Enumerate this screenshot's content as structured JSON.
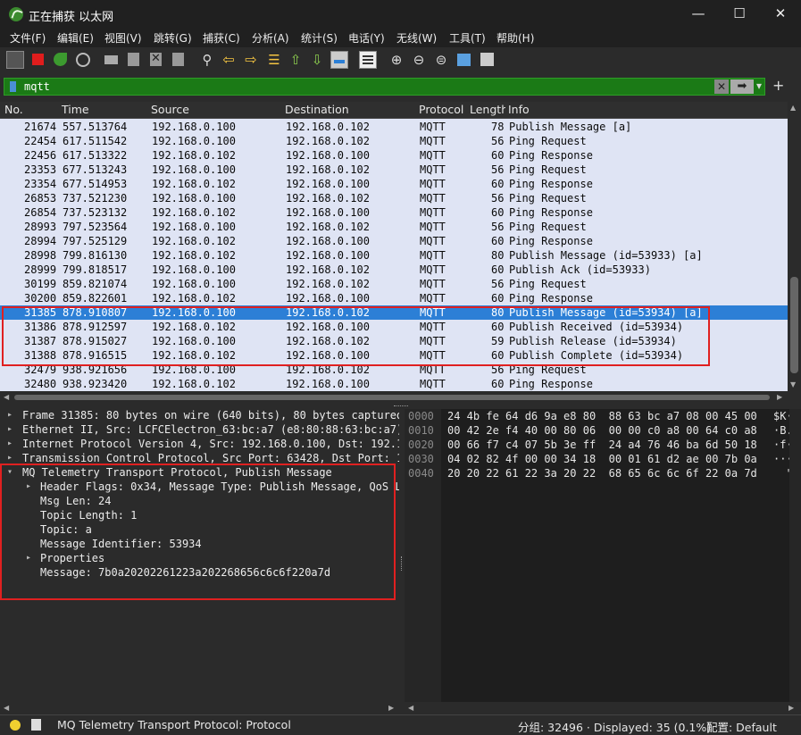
{
  "window": {
    "title": "正在捕获 以太网",
    "minimize": "—",
    "maximize": "☐",
    "close": "✕"
  },
  "menu": [
    "文件(F)",
    "编辑(E)",
    "视图(V)",
    "跳转(G)",
    "捕获(C)",
    "分析(A)",
    "统计(S)",
    "电话(Y)",
    "无线(W)",
    "工具(T)",
    "帮助(H)"
  ],
  "toolbar": [
    "shark-fin-icon",
    "stop-icon",
    "restart-capture-icon",
    "capture-options-icon",
    "open-folder-icon",
    "save-file-icon",
    "close-file-icon",
    "reload-icon",
    "find-packet-icon",
    "go-back-icon",
    "go-forward-icon",
    "go-to-packet-icon",
    "first-packet-icon",
    "last-packet-icon",
    "auto-scroll-icon",
    "colorize-icon",
    "zoom-in-icon",
    "zoom-out-icon",
    "zoom-reset-icon",
    "resize-columns-icon",
    "layout-icon"
  ],
  "filter": {
    "value": "mqtt",
    "clear": "✕",
    "apply": "➡",
    "dropdown": "▾",
    "add": "+"
  },
  "columns": [
    "No.",
    "Time",
    "Source",
    "Destination",
    "Protocol",
    "Length",
    "Info"
  ],
  "packets": [
    [
      "21674",
      "557.513764",
      "192.168.0.100",
      "192.168.0.102",
      "MQTT",
      "78",
      "Publish Message [a]"
    ],
    [
      "22454",
      "617.511542",
      "192.168.0.100",
      "192.168.0.102",
      "MQTT",
      "56",
      "Ping Request"
    ],
    [
      "22456",
      "617.513322",
      "192.168.0.102",
      "192.168.0.100",
      "MQTT",
      "60",
      "Ping Response"
    ],
    [
      "23353",
      "677.513243",
      "192.168.0.100",
      "192.168.0.102",
      "MQTT",
      "56",
      "Ping Request"
    ],
    [
      "23354",
      "677.514953",
      "192.168.0.102",
      "192.168.0.100",
      "MQTT",
      "60",
      "Ping Response"
    ],
    [
      "26853",
      "737.521230",
      "192.168.0.100",
      "192.168.0.102",
      "MQTT",
      "56",
      "Ping Request"
    ],
    [
      "26854",
      "737.523132",
      "192.168.0.102",
      "192.168.0.100",
      "MQTT",
      "60",
      "Ping Response"
    ],
    [
      "28993",
      "797.523564",
      "192.168.0.100",
      "192.168.0.102",
      "MQTT",
      "56",
      "Ping Request"
    ],
    [
      "28994",
      "797.525129",
      "192.168.0.102",
      "192.168.0.100",
      "MQTT",
      "60",
      "Ping Response"
    ],
    [
      "28998",
      "799.816130",
      "192.168.0.102",
      "192.168.0.100",
      "MQTT",
      "80",
      "Publish Message (id=53933) [a]"
    ],
    [
      "28999",
      "799.818517",
      "192.168.0.100",
      "192.168.0.102",
      "MQTT",
      "60",
      "Publish Ack (id=53933)"
    ],
    [
      "30199",
      "859.821074",
      "192.168.0.100",
      "192.168.0.102",
      "MQTT",
      "56",
      "Ping Request"
    ],
    [
      "30200",
      "859.822601",
      "192.168.0.102",
      "192.168.0.100",
      "MQTT",
      "60",
      "Ping Response"
    ],
    [
      "31385",
      "878.910807",
      "192.168.0.100",
      "192.168.0.102",
      "MQTT",
      "80",
      "Publish Message (id=53934) [a]"
    ],
    [
      "31386",
      "878.912597",
      "192.168.0.102",
      "192.168.0.100",
      "MQTT",
      "60",
      "Publish Received (id=53934)"
    ],
    [
      "31387",
      "878.915027",
      "192.168.0.100",
      "192.168.0.102",
      "MQTT",
      "59",
      "Publish Release (id=53934)"
    ],
    [
      "31388",
      "878.916515",
      "192.168.0.102",
      "192.168.0.100",
      "MQTT",
      "60",
      "Publish Complete (id=53934)"
    ],
    [
      "32479",
      "938.921656",
      "192.168.0.100",
      "192.168.0.102",
      "MQTT",
      "56",
      "Ping Request"
    ],
    [
      "32480",
      "938.923420",
      "192.168.0.102",
      "192.168.0.100",
      "MQTT",
      "60",
      "Ping Response"
    ]
  ],
  "selected_row": 13,
  "details": [
    {
      "text": "Frame 31385: 80 bytes on wire (640 bits), 80 bytes captured",
      "expander": "▸",
      "level": 0
    },
    {
      "text": "Ethernet II, Src: LCFCElectron_63:bc:a7 (e8:80:88:63:bc:a7)",
      "expander": "▸",
      "level": 0
    },
    {
      "text": "Internet Protocol Version 4, Src: 192.168.0.100, Dst: 192.1",
      "expander": "▸",
      "level": 0
    },
    {
      "text": "Transmission Control Protocol, Src Port: 63428, Dst Port: 1",
      "expander": "▸",
      "level": 0
    },
    {
      "text": "MQ Telemetry Transport Protocol, Publish Message",
      "expander": "▾",
      "level": 0
    },
    {
      "text": "Header Flags: 0x34, Message Type: Publish Message, QoS L",
      "expander": "▸",
      "level": 1
    },
    {
      "text": "Msg Len: 24",
      "expander": "",
      "level": 1
    },
    {
      "text": "Topic Length: 1",
      "expander": "",
      "level": 1
    },
    {
      "text": "Topic: a",
      "expander": "",
      "level": 1
    },
    {
      "text": "Message Identifier: 53934",
      "expander": "",
      "level": 1
    },
    {
      "text": "Properties",
      "expander": "▸",
      "level": 1
    },
    {
      "text": "Message: 7b0a20202261223a202268656c6c6f220a7d",
      "expander": "",
      "level": 1
    }
  ],
  "hex": [
    {
      "offset": "0000",
      "bytes": "24 4b fe 64 d6 9a e8 80  88 63 bc a7 08 00 45 00",
      "ascii": "$K·d"
    },
    {
      "offset": "0010",
      "bytes": "00 42 2e f4 40 00 80 06  00 00 c0 a8 00 64 c0 a8",
      "ascii": "·B.·"
    },
    {
      "offset": "0020",
      "bytes": "00 66 f7 c4 07 5b 3e ff  24 a4 76 46 ba 6d 50 18",
      "ascii": "·f··"
    },
    {
      "offset": "0030",
      "bytes": "04 02 82 4f 00 00 34 18  00 01 61 d2 ae 00 7b 0a",
      "ascii": "···O"
    },
    {
      "offset": "0040",
      "bytes": "20 20 22 61 22 3a 20 22  68 65 6c 6c 6f 22 0a 7d",
      "ascii": "  \"a"
    }
  ],
  "status": {
    "protocol_text": "MQ Telemetry Transport Protocol: Protocol",
    "packets_text": "分组: 32496 · Displayed: 35 (0.1%)",
    "profile_text": "配置: Default"
  },
  "colors": {
    "selected": "#2c7fd6",
    "list_bg": "#dfe4f4",
    "filter_bg": "#1b7a16",
    "highlight_box": "#e02020"
  }
}
